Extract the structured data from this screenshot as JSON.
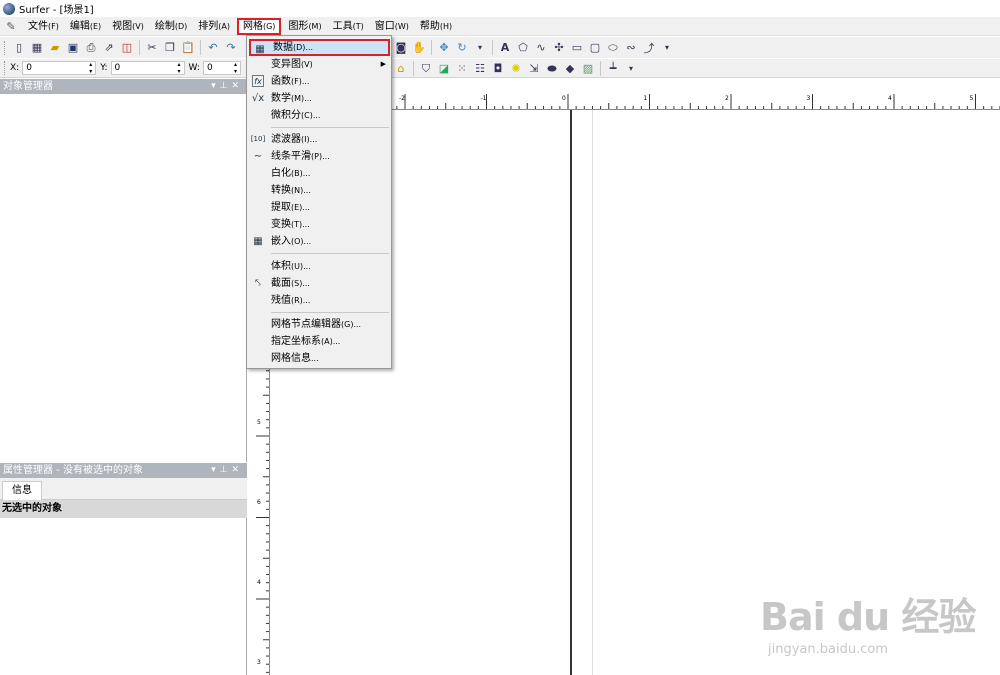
{
  "window": {
    "title": "Surfer - [场景1]"
  },
  "menubar": {
    "items": [
      {
        "label": "文件",
        "accel": "(F)"
      },
      {
        "label": "编辑",
        "accel": "(E)"
      },
      {
        "label": "视图",
        "accel": "(V)"
      },
      {
        "label": "绘制",
        "accel": "(D)"
      },
      {
        "label": "排列",
        "accel": "(A)"
      },
      {
        "label": "网格",
        "accel": "(G)"
      },
      {
        "label": "图形",
        "accel": "(M)"
      },
      {
        "label": "工具",
        "accel": "(T)"
      },
      {
        "label": "窗口",
        "accel": "(W)"
      },
      {
        "label": "帮助",
        "accel": "(H)"
      }
    ]
  },
  "coords": {
    "x": {
      "label": "X:",
      "value": "0"
    },
    "y": {
      "label": "Y:",
      "value": "0"
    },
    "w": {
      "label": "W:",
      "value": "0"
    }
  },
  "object_manager": {
    "title": "对象管理器"
  },
  "property_manager": {
    "title": "属性管理器 - 没有被选中的对象",
    "tab_info": "信息",
    "row": "无选中的对象"
  },
  "grid_menu": {
    "items": [
      {
        "label": "数据",
        "accel": "(D)...",
        "icon": "grid-data-icon"
      },
      {
        "label": "变异图",
        "accel": "(V)",
        "submenu": true
      },
      {
        "label": "函数",
        "accel": "(F)...",
        "icon": "function-icon"
      },
      {
        "label": "数学",
        "accel": "(M)...",
        "icon": "math-sqrt-icon"
      },
      {
        "label": "微积分",
        "accel": "(C)..."
      },
      {
        "label": "滤波器",
        "accel": "(I)...",
        "icon": "filter-icon"
      },
      {
        "label": "线条平滑",
        "accel": "(P)...",
        "icon": "smooth-icon"
      },
      {
        "label": "白化",
        "accel": "(B)..."
      },
      {
        "label": "转换",
        "accel": "(N)..."
      },
      {
        "label": "提取",
        "accel": "(E)..."
      },
      {
        "label": "变换",
        "accel": "(T)..."
      },
      {
        "label": "嵌入",
        "accel": "(O)...",
        "icon": "mosaic-icon"
      },
      {
        "label": "体积",
        "accel": "(U)..."
      },
      {
        "label": "截面",
        "accel": "(S)...",
        "icon": "slice-icon"
      },
      {
        "label": "残值",
        "accel": "(R)..."
      },
      {
        "label": "网格节点编辑器",
        "accel": "(G)..."
      },
      {
        "label": "指定坐标系",
        "accel": "(A)..."
      },
      {
        "label": "网格信息",
        "accel": "..."
      }
    ]
  },
  "ruler": {
    "top_labels": [
      "-2",
      "-1",
      "0",
      "1",
      "2",
      "3",
      "4",
      "5"
    ],
    "left_labels": [
      "5",
      "6",
      "4",
      "3"
    ]
  },
  "watermark": {
    "main": "Bai du 经验",
    "sub": "jingyan.baidu.com"
  },
  "colors": {
    "highlight_border": "#d8222a",
    "menu_hover": "#cce4f7",
    "panel_header": "#aeb5bd"
  }
}
